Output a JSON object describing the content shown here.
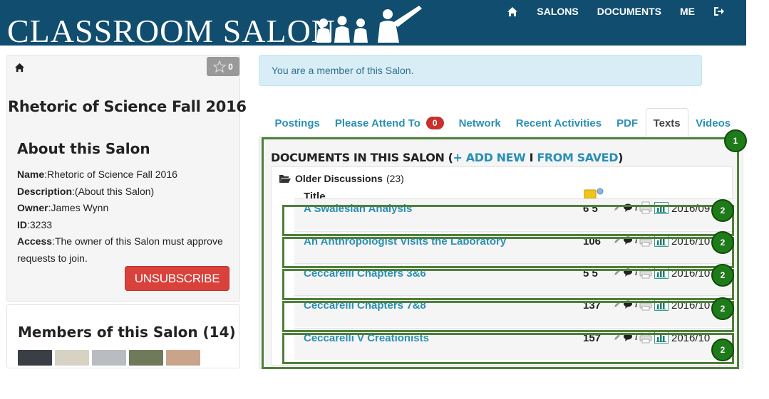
{
  "header": {
    "logo_text": "CLASSROOM SALON",
    "nav": {
      "salons": "SALONS",
      "documents": "DOCUMENTS",
      "me": "ME"
    },
    "bg_color": "#114d6f"
  },
  "sidebar": {
    "star_count": "0",
    "salon_name": "Rhetoric of Science Fall 2016",
    "about": {
      "heading": "About this Salon",
      "name_label": "Name",
      "name_value": "Rhetoric of Science Fall 2016",
      "description_label": "Description",
      "description_value": "(About this Salon)",
      "owner_label": "Owner",
      "owner_value": "James Wynn",
      "id_label": "ID",
      "id_value": "3233",
      "access_label": "Access",
      "access_value": "The owner of this Salon must approve requests to join."
    },
    "unsubscribe_label": "UNSUBSCRIBE",
    "members_heading": "Members of this Salon (14)"
  },
  "alert": {
    "text": "You are a member of this Salon."
  },
  "tabs": [
    {
      "label": "Postings"
    },
    {
      "label": "Please Attend To",
      "badge": "0"
    },
    {
      "label": "Network"
    },
    {
      "label": "Recent Activities"
    },
    {
      "label": "PDF"
    },
    {
      "label": "Texts",
      "active": true
    },
    {
      "label": "Videos"
    }
  ],
  "documents": {
    "title_prefix": "DOCUMENTS IN THIS SALON (",
    "add_new": "+ ADD NEW",
    "separator": " I ",
    "from_saved": "FROM SAVED",
    "title_suffix": ")",
    "folder_name": "Older Discussions",
    "folder_count": " (23)",
    "column_title": "Title",
    "rows": [
      {
        "title": "A Swalesian Analysis",
        "count": "6  5",
        "date": "2016/09"
      },
      {
        "title": "An Anthropologist Visits the Laboratory",
        "count": "106",
        "date": "2016/10"
      },
      {
        "title": "Ceccarelli Chapters 3&6",
        "count": "5  5",
        "date": "2016/10"
      },
      {
        "title": "Ceccarelli Chapters 7&8",
        "count": "137",
        "date": "2016/10"
      },
      {
        "title": "Ceccarelli V Creationists",
        "count": "157",
        "date": "2016/10"
      }
    ]
  },
  "annotations": {
    "main_marker": "1",
    "row_marker": "2",
    "color": "#4e7f3a"
  }
}
